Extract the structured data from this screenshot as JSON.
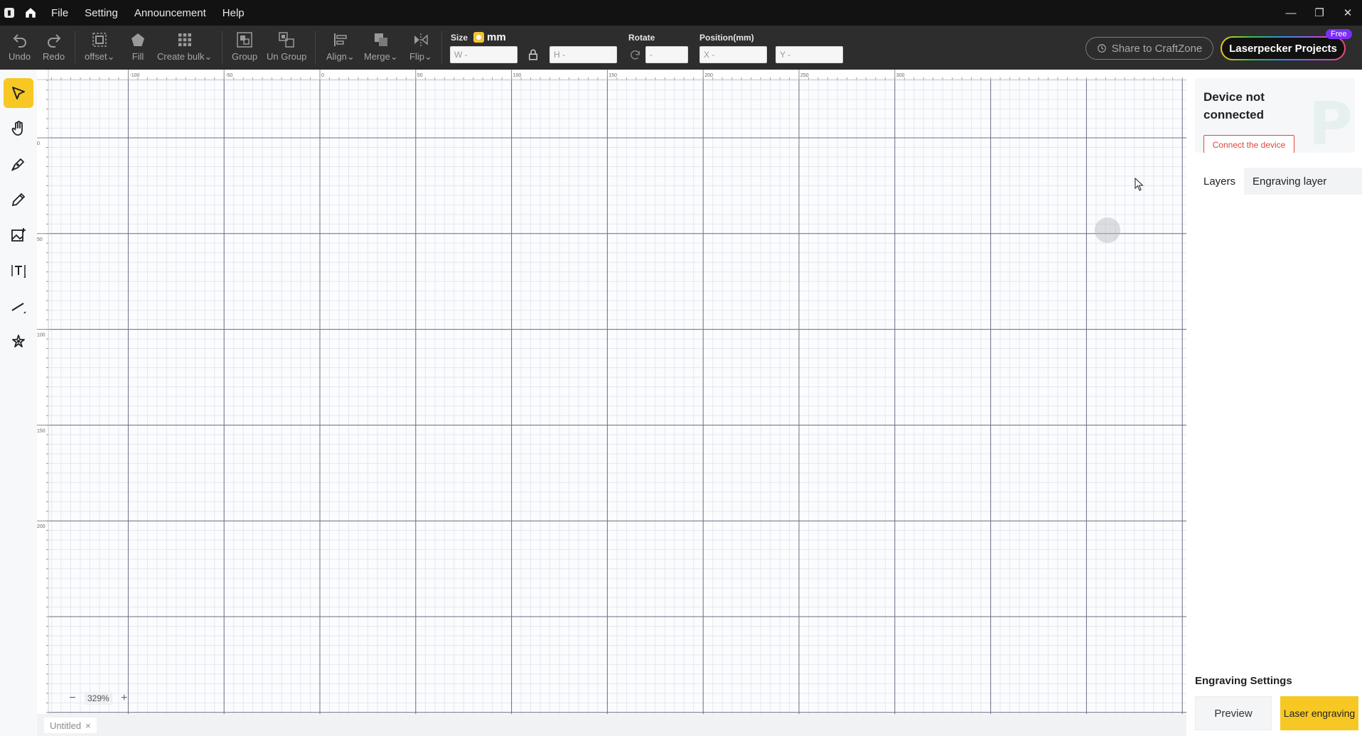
{
  "titlebar": {
    "menu": [
      "File",
      "Setting",
      "Announcement",
      "Help"
    ],
    "window_controls": [
      "minimize-icon",
      "restore-icon",
      "close-icon"
    ]
  },
  "toolbar": {
    "undo": "Undo",
    "redo": "Redo",
    "offset": "offset",
    "fill": "Fill",
    "create_bulk": "Create bulk",
    "group": "Group",
    "ungroup": "Un Group",
    "align": "Align",
    "merge": "Merge",
    "flip": "Flip",
    "size_label": "Size",
    "unit": "mm",
    "w_placeholder": "W -",
    "h_placeholder": "H -",
    "rotate_label": "Rotate",
    "rotate_placeholder": "-",
    "position_label": "Position(mm)",
    "x_placeholder": "X -",
    "y_placeholder": "Y -",
    "share": "Share to CraftZone",
    "projects": "Laserpecker Projects",
    "free_badge": "Free"
  },
  "left_tools": [
    "select-arrow-icon",
    "hand-pan-icon",
    "pen-curve-icon",
    "pencil-icon",
    "add-image-icon",
    "text-tool-icon",
    "line-tool-icon",
    "magic-wand-icon"
  ],
  "canvas": {
    "x_ruler": [
      "-100",
      "-50",
      "0",
      "50",
      "100",
      "150",
      "200",
      "250",
      "300"
    ],
    "y_ruler": [
      "0",
      "50",
      "100",
      "150",
      "200"
    ],
    "zoom": "329%"
  },
  "tabbar": {
    "doc_tab": "Untitled"
  },
  "right_panel": {
    "device_status": "Device not connected",
    "connect_button": "Connect the device",
    "tabs": [
      "Layers",
      "Engraving layer"
    ],
    "engraving_settings": "Engraving Settings",
    "preview": "Preview",
    "laser_engraving": "Laser engraving"
  },
  "colors": {
    "accent": "#f7c824",
    "titlebar": "#121212",
    "toolbar": "#2d2d2d",
    "danger": "#e0463c"
  }
}
